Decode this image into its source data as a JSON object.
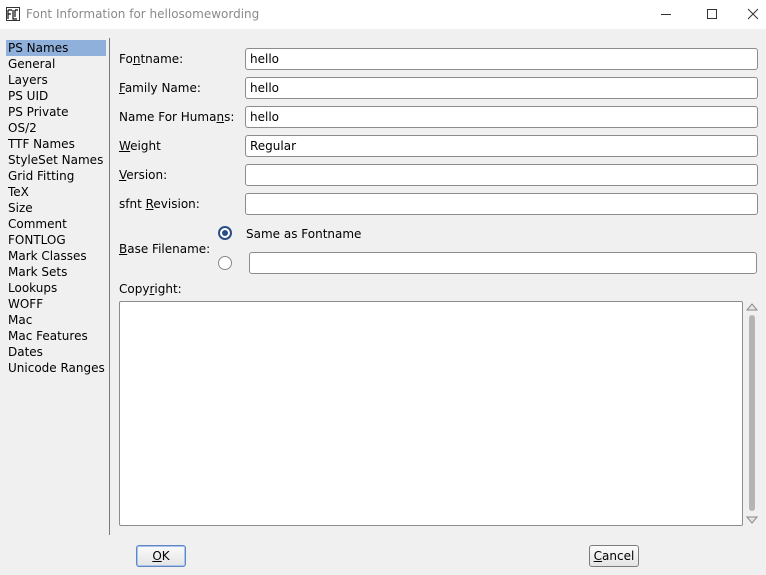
{
  "window": {
    "title": "Font Information for hellosomewording",
    "app_icon": "fontforge-icon",
    "controls": [
      "minimize-icon",
      "maximize-icon",
      "close-icon"
    ]
  },
  "sidebar": {
    "items": [
      {
        "label": "PS Names",
        "selected": true
      },
      {
        "label": "General"
      },
      {
        "label": "Layers"
      },
      {
        "label": "PS UID"
      },
      {
        "label": "PS Private"
      },
      {
        "label": "OS/2"
      },
      {
        "label": "TTF Names"
      },
      {
        "label": "StyleSet Names"
      },
      {
        "label": "Grid Fitting"
      },
      {
        "label": "TeX"
      },
      {
        "label": "Size"
      },
      {
        "label": "Comment"
      },
      {
        "label": "FONTLOG"
      },
      {
        "label": "Mark Classes"
      },
      {
        "label": "Mark Sets"
      },
      {
        "label": "Lookups"
      },
      {
        "label": "WOFF"
      },
      {
        "label": "Mac"
      },
      {
        "label": "Mac Features"
      },
      {
        "label": "Dates"
      },
      {
        "label": "Unicode Ranges"
      }
    ]
  },
  "form": {
    "fontname": {
      "pre": "Fo",
      "u": "n",
      "post": "tname:",
      "value": "hello"
    },
    "family_name": {
      "pre": "",
      "u": "F",
      "post": "amily Name:",
      "value": "hello"
    },
    "name_for_humans": {
      "pre": "Name For Huma",
      "u": "n",
      "post": "s:",
      "value": "hello"
    },
    "weight": {
      "pre": "",
      "u": "W",
      "post": "eight",
      "value": "Regular"
    },
    "version": {
      "pre": "",
      "u": "V",
      "post": "ersion:",
      "value": ""
    },
    "sfnt_revision": {
      "pre": "sfnt ",
      "u": "R",
      "post": "evision:",
      "value": ""
    },
    "base_filename": {
      "pre": "",
      "u": "B",
      "post": "ase Filename:",
      "option_same": "Same as Fontname",
      "selected": "same",
      "custom_value": ""
    },
    "copyright": {
      "pre": "Copy",
      "u": "r",
      "post": "ight:",
      "value": ""
    }
  },
  "buttons": {
    "ok": {
      "pre": "",
      "u": "O",
      "post": "K"
    },
    "cancel": {
      "pre": "",
      "u": "C",
      "post": "ancel"
    }
  },
  "colors": {
    "selection": "#90b0dc",
    "radio_accent": "#2a4e86",
    "window_bg": "#f0f0f0"
  }
}
